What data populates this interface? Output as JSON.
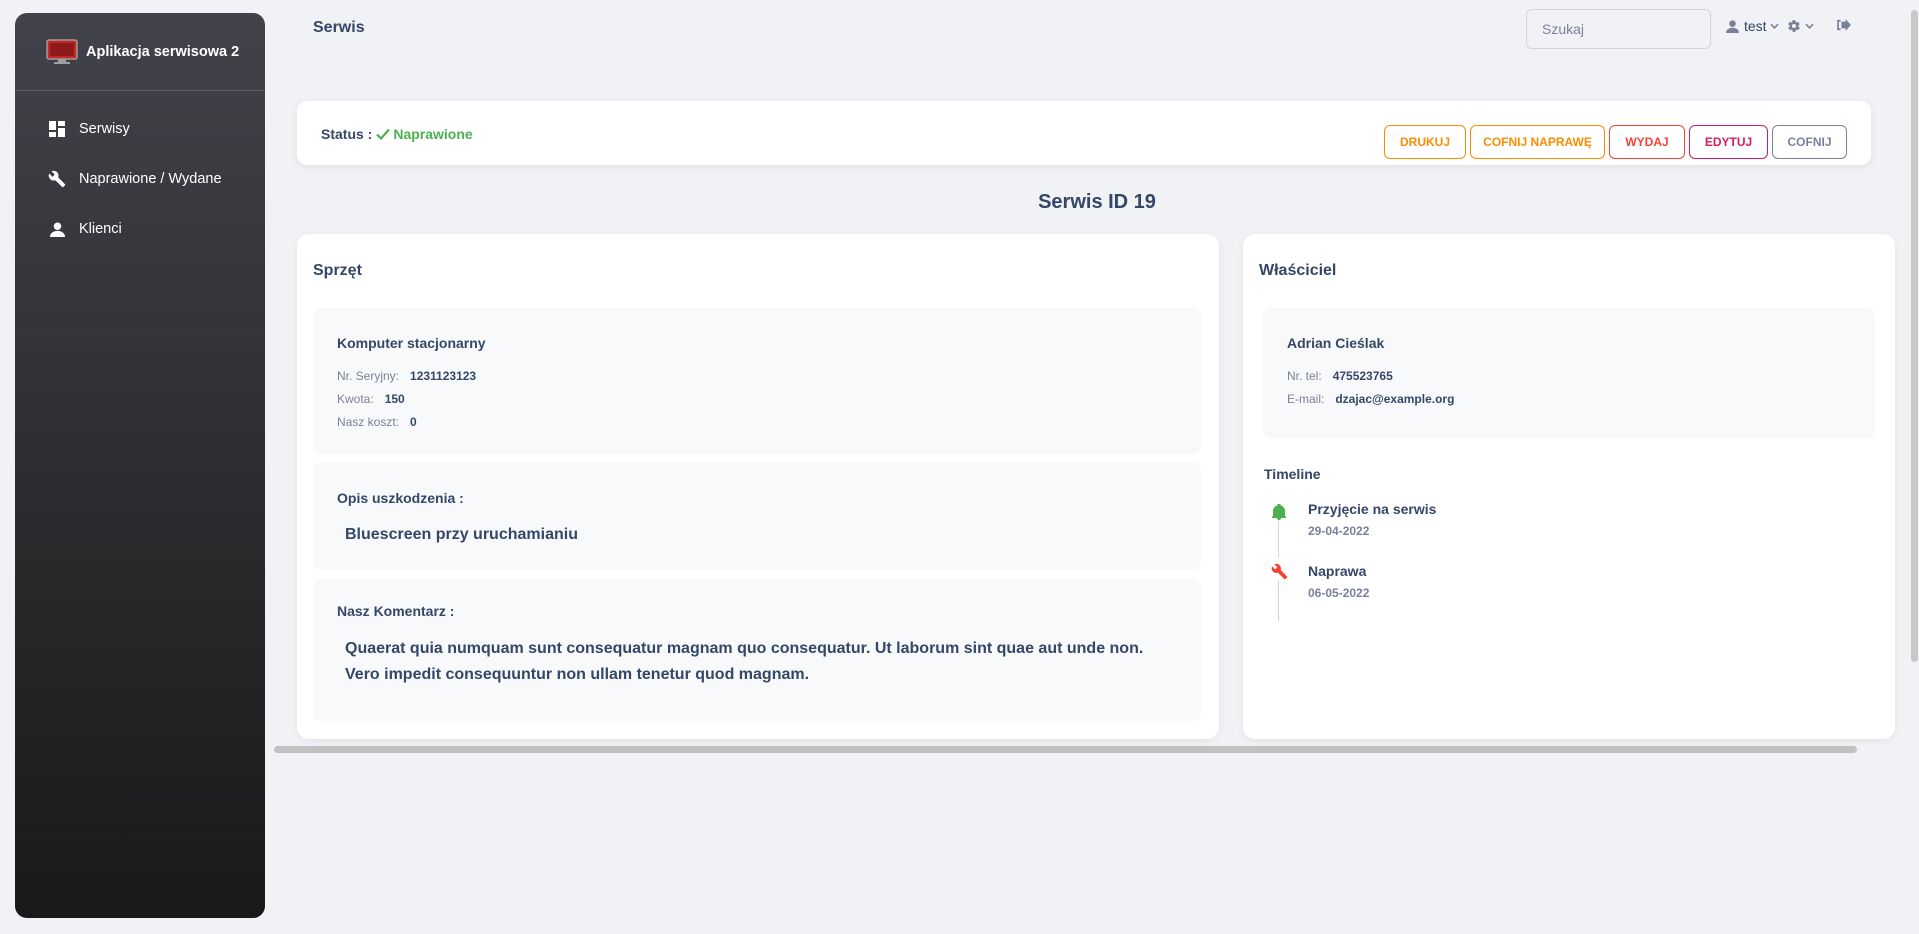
{
  "sidebar": {
    "brand": "Aplikacja serwisowa 2",
    "items": [
      {
        "label": "Serwisy",
        "icon": "dashboard-icon"
      },
      {
        "label": "Naprawione / Wydane",
        "icon": "wrench-icon"
      },
      {
        "label": "Klienci",
        "icon": "person-icon"
      }
    ]
  },
  "topbar": {
    "title": "Serwis",
    "search_placeholder": "Szukaj",
    "user": "test"
  },
  "status": {
    "label": "Status :",
    "value": "Naprawione",
    "color": "#4caf50"
  },
  "actions": {
    "print": "DRUKUJ",
    "undo_repair": "COFNIJ NAPRAWĘ",
    "issue": "WYDAJ",
    "edit": "EDYTUJ",
    "back": "COFNIJ"
  },
  "page": {
    "heading": "Serwis ID 19"
  },
  "equipment": {
    "title": "Sprzęt",
    "device_name": "Komputer stacjonarny",
    "serial_label": "Nr. Seryjny:",
    "serial_value": "1231123123",
    "amount_label": "Kwota:",
    "amount_value": "150",
    "cost_label": "Nasz koszt:",
    "cost_value": "0",
    "damage_title": "Opis uszkodzenia :",
    "damage_text": "Bluescreen przy uruchamianiu",
    "comment_title": "Nasz Komentarz :",
    "comment_text": "Quaerat quia numquam sunt consequatur magnam quo consequatur. Ut laborum sint quae aut unde non. Vero impedit consequuntur non ullam tenetur quod magnam."
  },
  "owner": {
    "title": "Właściciel",
    "name": "Adrian Cieślak",
    "phone_label": "Nr. tel:",
    "phone_value": "475523765",
    "email_label": "E-mail:",
    "email_value": "dzajac@example.org"
  },
  "timeline": {
    "title": "Timeline",
    "events": [
      {
        "title": "Przyjęcie na serwis",
        "date": "29-04-2022",
        "icon": "bell-icon",
        "color": "#4caf50"
      },
      {
        "title": "Naprawa",
        "date": "06-05-2022",
        "icon": "wrench-icon",
        "color": "#f44335"
      }
    ]
  }
}
